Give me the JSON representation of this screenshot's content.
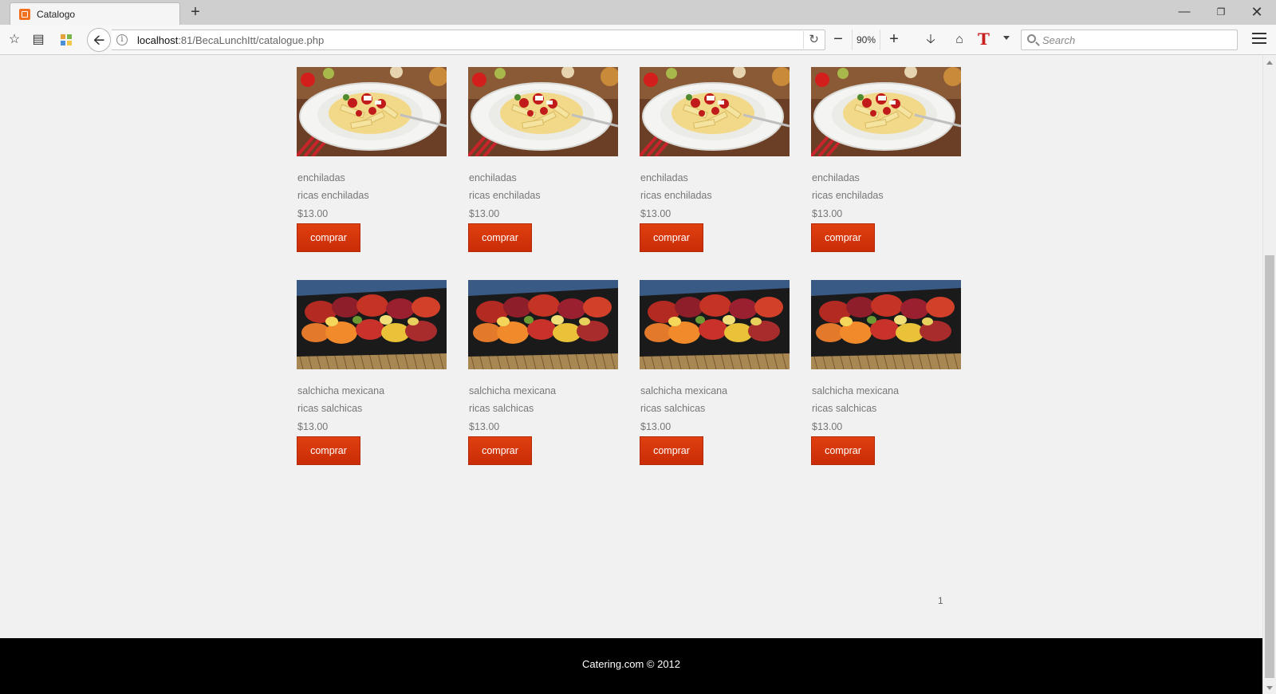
{
  "browser": {
    "tab_title": "Catalogo",
    "url_host": "localhost",
    "url_rest": ":81/BecaLunchItt/catalogue.php",
    "zoom": "90%",
    "search_placeholder": "Search"
  },
  "products": [
    {
      "name": "enchiladas",
      "desc": "ricas enchiladas",
      "price": "$13.00",
      "button": "comprar",
      "image": "pasta-dish"
    },
    {
      "name": "enchiladas",
      "desc": "ricas enchiladas",
      "price": "$13.00",
      "button": "comprar",
      "image": "pasta-dish"
    },
    {
      "name": "enchiladas",
      "desc": "ricas enchiladas",
      "price": "$13.00",
      "button": "comprar",
      "image": "pasta-dish"
    },
    {
      "name": "enchiladas",
      "desc": "ricas enchiladas",
      "price": "$13.00",
      "button": "comprar",
      "image": "pasta-dish"
    },
    {
      "name": "salchicha mexicana",
      "desc": "ricas salchicas",
      "price": "$13.00",
      "button": "comprar",
      "image": "roasted-vegetables"
    },
    {
      "name": "salchicha mexicana",
      "desc": "ricas salchicas",
      "price": "$13.00",
      "button": "comprar",
      "image": "roasted-vegetables"
    },
    {
      "name": "salchicha mexicana",
      "desc": "ricas salchicas",
      "price": "$13.00",
      "button": "comprar",
      "image": "roasted-vegetables"
    },
    {
      "name": "salchicha mexicana",
      "desc": "ricas salchicas",
      "price": "$13.00",
      "button": "comprar",
      "image": "roasted-vegetables"
    }
  ],
  "pagination": {
    "current_page": "1"
  },
  "footer": {
    "text": "Catering.com © 2012"
  },
  "colors": {
    "button": "#d4330a",
    "footer": "#000000",
    "page_bg": "#f1f1f1"
  }
}
